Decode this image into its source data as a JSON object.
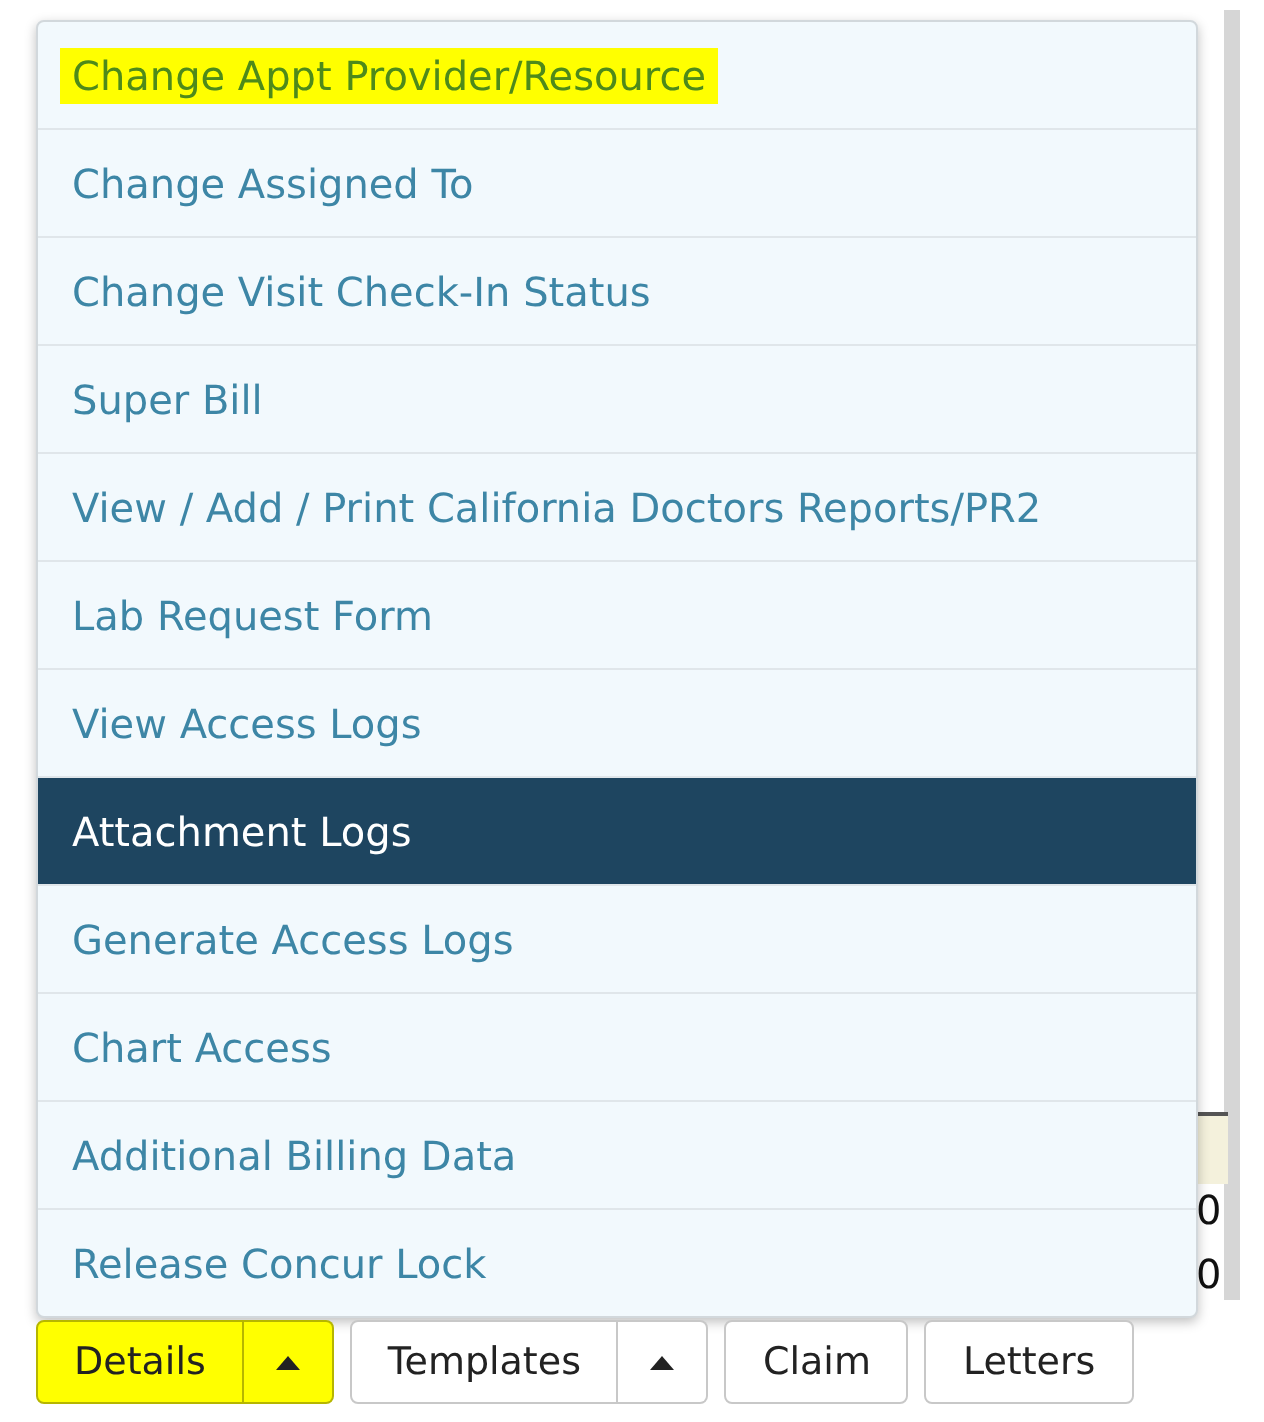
{
  "menu": {
    "items": [
      {
        "label": "Change Appt Provider/Resource",
        "selected": false,
        "highlighted": true
      },
      {
        "label": "Change Assigned To",
        "selected": false,
        "highlighted": false
      },
      {
        "label": "Change Visit Check-In Status",
        "selected": false,
        "highlighted": false
      },
      {
        "label": "Super Bill",
        "selected": false,
        "highlighted": false
      },
      {
        "label": "View / Add / Print California Doctors Reports/PR2",
        "selected": false,
        "highlighted": false
      },
      {
        "label": "Lab Request Form",
        "selected": false,
        "highlighted": false
      },
      {
        "label": "View Access Logs",
        "selected": false,
        "highlighted": false
      },
      {
        "label": "Attachment Logs",
        "selected": true,
        "highlighted": false
      },
      {
        "label": "Generate Access Logs",
        "selected": false,
        "highlighted": false
      },
      {
        "label": "Chart Access",
        "selected": false,
        "highlighted": false
      },
      {
        "label": "Additional Billing Data",
        "selected": false,
        "highlighted": false
      },
      {
        "label": "Release Concur Lock",
        "selected": false,
        "highlighted": false
      }
    ]
  },
  "table": {
    "cells": [
      "0",
      "0"
    ]
  },
  "buttons": [
    {
      "kind": "split",
      "label": "Details",
      "highlighted": true
    },
    {
      "kind": "split",
      "label": "Templates",
      "highlighted": false
    },
    {
      "kind": "plain",
      "label": "Claim",
      "highlighted": false
    },
    {
      "kind": "plain",
      "label": "Letters",
      "highlighted": false
    }
  ]
}
